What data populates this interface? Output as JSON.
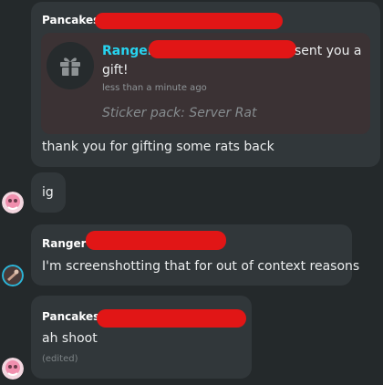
{
  "messages": [
    {
      "sender": "Pancakes",
      "gift": {
        "from": "Ranger",
        "text_after": "sent you a",
        "text_line2": "gift!",
        "time": "less than a minute ago",
        "pack": "Sticker pack: Server Rat"
      },
      "text": "thank you for gifting some rats back"
    },
    {
      "text": "ig"
    },
    {
      "sender": "Ranger",
      "text": "I'm screenshotting that for out of context reasons"
    },
    {
      "sender": "Pancakes",
      "text": "ah shoot",
      "edited": "(edited)"
    }
  ],
  "icons": {
    "gift": "gift-icon",
    "avatar_pancakes": "avatar-pancakes",
    "avatar_ranger": "avatar-ranger"
  },
  "colors": {
    "background": "#24292b",
    "bubble": "#31373a",
    "gift_card": "#3b3234",
    "ranger_name": "#27d4f0",
    "redaction": "#e11616"
  }
}
